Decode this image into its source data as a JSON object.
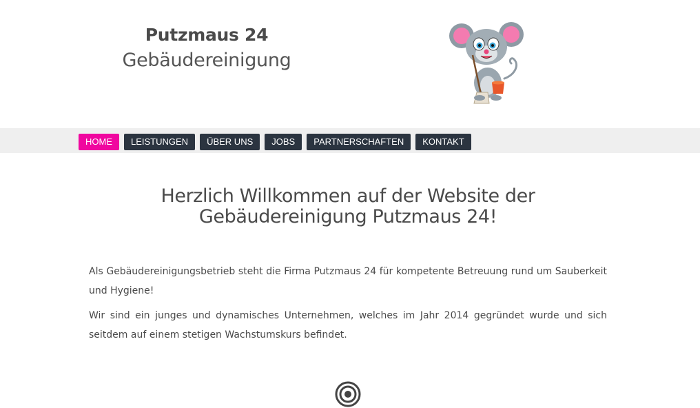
{
  "header": {
    "brand_name": "Putzmaus 24",
    "brand_sub": "Gebäudereinigung",
    "mascot_icon": "mouse-with-broom-icon"
  },
  "nav": {
    "items": [
      {
        "label": "HOME",
        "active": true
      },
      {
        "label": "LEISTUNGEN",
        "active": false
      },
      {
        "label": "ÜBER UNS",
        "active": false
      },
      {
        "label": "JOBS",
        "active": false
      },
      {
        "label": "PARTNERSCHAFTEN",
        "active": false
      },
      {
        "label": "KONTAKT",
        "active": false
      }
    ]
  },
  "main": {
    "title_line1": "Herzlich Willkommen auf der Website der",
    "title_line2": "Gebäudereinigung Putzmaus 24!",
    "paragraphs": [
      "Als Gebäudereinigungsbetrieb steht die Firma Putzmaus 24 für kompetente Betreuung rund um Sauberkeit und Hygiene!",
      "Wir sind ein junges und dynamisches Unternehmen, welches im Jahr 2014 gegründet wurde und sich seitdem auf einem stetigen Wachstumskurs befindet."
    ],
    "bottom_icon": "target-icon"
  },
  "colors": {
    "accent": "#f0079f",
    "nav_bg": "#2b3440",
    "nav_bar": "#efefef",
    "text": "#4a4a4a"
  }
}
